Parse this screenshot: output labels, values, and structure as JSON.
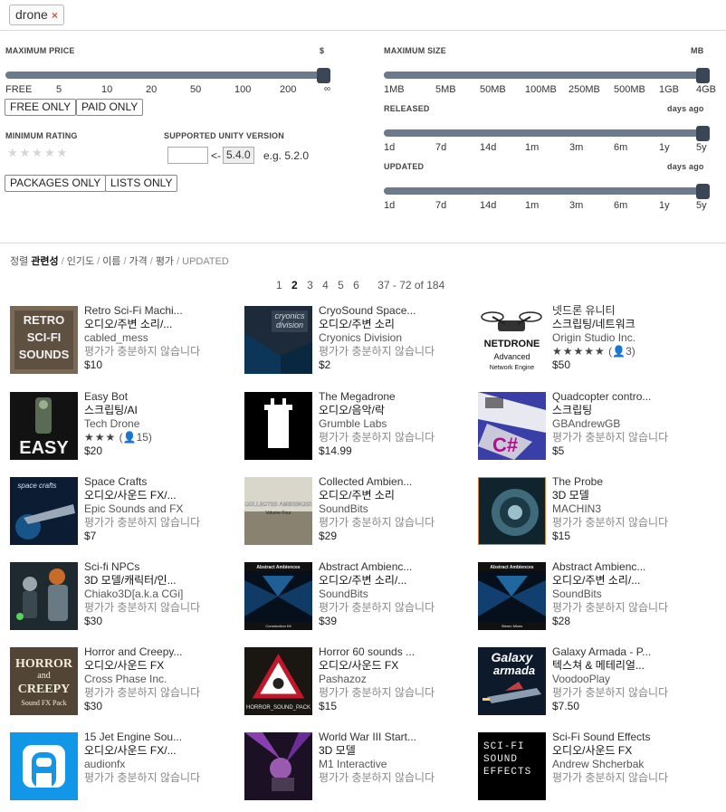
{
  "search": {
    "tag": "drone",
    "remove": "×"
  },
  "filters": {
    "max_price": {
      "label": "MAXIMUM PRICE",
      "unit": "$",
      "ticks": [
        "FREE",
        "5",
        "10",
        "20",
        "50",
        "100",
        "200",
        "∞"
      ],
      "value_fraction": 1.0
    },
    "free_only": "FREE ONLY",
    "paid_only": "PAID ONLY",
    "min_rating": {
      "label": "MINIMUM RATING",
      "stars": "★★★★★"
    },
    "unity_version": {
      "label": "SUPPORTED UNITY VERSION",
      "arrow": "<-",
      "current": "5.4.0",
      "example": "e.g. 5.2.0",
      "value": ""
    },
    "packages_only": "PACKAGES ONLY",
    "lists_only": "LISTS ONLY",
    "max_size": {
      "label": "MAXIMUM SIZE",
      "unit": "MB",
      "ticks": [
        "1MB",
        "5MB",
        "50MB",
        "100MB",
        "250MB",
        "500MB",
        "1GB",
        "4GB"
      ],
      "value_fraction": 1.0
    },
    "released": {
      "label": "RELEASED",
      "unit": "days ago",
      "ticks": [
        "1d",
        "7d",
        "14d",
        "1m",
        "3m",
        "6m",
        "1y",
        "5y"
      ],
      "value_fraction": 1.0
    },
    "updated": {
      "label": "UPDATED",
      "unit": "days ago",
      "ticks": [
        "1d",
        "7d",
        "14d",
        "1m",
        "3m",
        "6m",
        "1y",
        "5y"
      ],
      "value_fraction": 1.0
    }
  },
  "sort": {
    "prefix": "정렬",
    "options": [
      "관련성",
      "인기도",
      "이름",
      "가격",
      "평가",
      "UPDATED"
    ],
    "active": "관련성"
  },
  "pagination": {
    "pages": [
      "1",
      "2",
      "3",
      "4",
      "5",
      "6"
    ],
    "current": "2",
    "range": "37 - 72 of 184"
  },
  "items": [
    {
      "title": "Retro Sci-Fi Machi...",
      "category": "오디오/주변 소리/...",
      "publisher": "cabled_mess",
      "rating_text": "평가가 충분하지 않습니다",
      "price": "$10",
      "icon": "retro-scifi-sounds-thumbnail",
      "thumb_text": [
        "RETRO",
        "SCI-FI",
        "SOUNDS"
      ]
    },
    {
      "title": "CryoSound Space...",
      "category": "오디오/주변 소리",
      "publisher": "Cryonics Division",
      "rating_text": "평가가 충분하지 않습니다",
      "price": "$2",
      "icon": "cryonics-division-thumbnail",
      "thumb_text": [
        "cryonics",
        "division"
      ]
    },
    {
      "title": "넷드론 유니티",
      "category": "스크립팅/네트워크",
      "publisher": "Origin Studio Inc.",
      "stars": "★★★★★",
      "review_count": "(👤3)",
      "price": "$50",
      "icon": "netdrone-thumbnail",
      "thumb_text": [
        "NETDRONE",
        "Advanced",
        "Network Engine"
      ]
    },
    {
      "title": "Easy Bot",
      "category": "스크립팅/AI",
      "publisher": "Tech Drone",
      "stars": "★★★",
      "review_count": "(👤15)",
      "price": "$20",
      "icon": "easy-bot-thumbnail",
      "thumb_text": [
        "EASY"
      ]
    },
    {
      "title": "The Megadrone",
      "category": "오디오/음악/락",
      "publisher": "Grumble Labs",
      "rating_text": "평가가 충분하지 않습니다",
      "price": "$14.99",
      "icon": "megadrone-thumbnail"
    },
    {
      "title": "Quadcopter contro...",
      "category": "스크립팅",
      "publisher": "GBAndrewGB",
      "rating_text": "평가가 충분하지 않습니다",
      "price": "$5",
      "icon": "quadcopter-thumbnail",
      "thumb_text": [
        "C#"
      ]
    },
    {
      "title": "Space Crafts",
      "category": "오디오/사운드 FX/...",
      "publisher": "Epic Sounds and FX",
      "rating_text": "평가가 충분하지 않습니다",
      "price": "$7",
      "icon": "space-crafts-thumbnail",
      "thumb_text": [
        "space crafts"
      ]
    },
    {
      "title": "Collected Ambien...",
      "category": "오디오/주변 소리",
      "publisher": "SoundBits",
      "rating_text": "평가가 충분하지 않습니다",
      "price": "$29",
      "icon": "collected-ambiences-thumbnail",
      "thumb_text": [
        "COLLECTED AMBIENCES",
        "Volume Four"
      ]
    },
    {
      "title": "The Probe",
      "category": "3D 모델",
      "publisher": "MACHIN3",
      "rating_text": "평가가 충분하지 않습니다",
      "price": "$15",
      "icon": "the-probe-thumbnail"
    },
    {
      "title": "Sci-fi NPCs",
      "category": "3D 모델/캐릭터/인...",
      "publisher": "Chiako3D[a.k.a CGi]",
      "rating_text": "평가가 충분하지 않습니다",
      "price": "$30",
      "icon": "scifi-npcs-thumbnail"
    },
    {
      "title": "Abstract Ambienc...",
      "category": "오디오/주변 소리/...",
      "publisher": "SoundBits",
      "rating_text": "평가가 충분하지 않습니다",
      "price": "$39",
      "icon": "abstract-ambiences-thumbnail",
      "thumb_text": [
        "Abstract Ambiences",
        "Construction Kit"
      ]
    },
    {
      "title": "Abstract Ambienc...",
      "category": "오디오/주변 소리/...",
      "publisher": "SoundBits",
      "rating_text": "평가가 충분하지 않습니다",
      "price": "$28",
      "icon": "abstract-ambiences-thumbnail",
      "thumb_text": [
        "Abstract Ambiences",
        "Stereo Mixes"
      ]
    },
    {
      "title": "Horror and Creepy...",
      "category": "오디오/사운드 FX",
      "publisher": "Cross Phase Inc.",
      "rating_text": "평가가 충분하지 않습니다",
      "price": "$30",
      "icon": "horror-creepy-thumbnail",
      "thumb_text": [
        "HORROR",
        "and",
        "CREEPY",
        "Sound FX Pack"
      ]
    },
    {
      "title": "Horror 60 sounds ...",
      "category": "오디오/사운드 FX",
      "publisher": "Pashazoz",
      "rating_text": "평가가 충분하지 않습니다",
      "price": "$15",
      "icon": "horror-sound-pack-thumbnail",
      "thumb_text": [
        "HORROR_SOUND_PACK"
      ]
    },
    {
      "title": "Galaxy Armada - P...",
      "category": "텍스쳐 & 메테리얼...",
      "publisher": "VoodooPlay",
      "rating_text": "평가가 충분하지 않습니다",
      "price": "$7.50",
      "icon": "galaxy-armada-thumbnail",
      "thumb_text": [
        "Galaxy",
        "armada"
      ]
    },
    {
      "title": "15 Jet Engine Sou...",
      "category": "오디오/사운드 FX/...",
      "publisher": "audionfx",
      "rating_text": "평가가 충분하지 않습니다",
      "price": "",
      "icon": "audionfx-thumbnail"
    },
    {
      "title": "World War III Start...",
      "category": "3D 모델",
      "publisher": "M1 Interactive",
      "rating_text": "평가가 충분하지 않습니다",
      "price": "",
      "icon": "world-war-3-thumbnail"
    },
    {
      "title": "Sci-Fi Sound Effects",
      "category": "오디오/사운드 FX",
      "publisher": "Andrew Shcherbak",
      "rating_text": "평가가 충분하지 않습니다",
      "price": "",
      "icon": "scifi-sound-effects-thumbnail",
      "thumb_text": [
        "SCI-FI",
        "SOUND",
        "EFFECTS"
      ]
    }
  ]
}
